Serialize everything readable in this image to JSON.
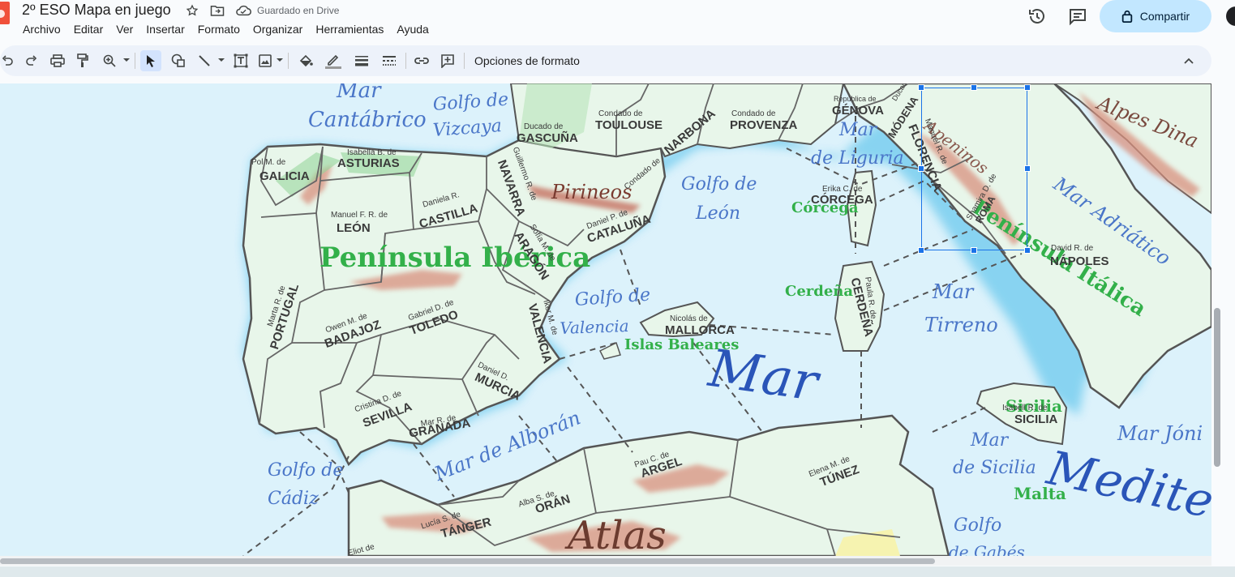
{
  "header": {
    "doc_title": "2º ESO Mapa en juego",
    "save_status": "Guardado en Drive",
    "share_label": "Compartir"
  },
  "menu": [
    "Archivo",
    "Editar",
    "Ver",
    "Insertar",
    "Formato",
    "Organizar",
    "Herramientas",
    "Ayuda"
  ],
  "toolbar": {
    "format_options": "Opciones de formato",
    "icons": [
      "undo-icon",
      "redo-icon",
      "print-icon",
      "paint-format-icon",
      "zoom-icon",
      "select-icon",
      "shape-icon",
      "line-icon",
      "textbox-icon",
      "image-icon",
      "fill-color-icon",
      "border-color-icon",
      "border-weight-icon",
      "border-dash-icon",
      "link-icon",
      "comment-icon",
      "collapse-icon"
    ]
  },
  "colors": {
    "accent": "#1a73e8",
    "share_bg": "#c2e7ff",
    "sea": "#dcf2fb",
    "land": "#e8f6ea",
    "border": "#555555"
  },
  "map": {
    "seas": {
      "mar": "Mar",
      "cantabrico": "Cantábrico",
      "golfo_vizcaya_1": "Golfo de",
      "golfo_vizcaya_2": "Vizcaya",
      "golfo_leon_1": "Golfo de",
      "golfo_leon_2": "León",
      "golfo_valencia_1": "Golfo de",
      "golfo_valencia_2": "Valencia",
      "mar_ligur_1": "Mar",
      "mar_ligur_2": "de Liguria",
      "mar_tirreno_1": "Mar",
      "mar_tirreno_2": "Tirreno",
      "mar_big": "Mar",
      "mediterraneo": "Medite",
      "mar_adriatico": "Mar Adriático",
      "mar_jonico": "Mar Jóni",
      "mar_sicilia_1": "Mar",
      "mar_sicilia_2": "de Sicilia",
      "mar_alboran": "Mar de Alborán",
      "golfo_cadiz_1": "Golfo de",
      "golfo_cadiz_2": "Cádiz",
      "golfo_gabes_1": "Golfo",
      "golfo_gabes_2": "de Gabés"
    },
    "geo": {
      "peninsula_iberica": "Península Ibérica",
      "peninsula_italica": "Península Itálica",
      "corcega": "Córcega",
      "cerdena": "Cerdeña",
      "islas_baleares": "Islas Baleares",
      "sicilia": "Sicilia",
      "malta": "Malta",
      "pirineos": "Pirineos",
      "atlas": "Atlas",
      "alpes": "Alpes Dina",
      "apeninos": "Apeninos"
    },
    "regions": {
      "galicia": {
        "owner": "Pol M. de",
        "name": "GALICIA"
      },
      "asturias": {
        "owner": "Isabella B. de",
        "name": "ASTURIAS"
      },
      "leon": {
        "owner": "Manuel F. R. de",
        "name": "LEÓN"
      },
      "castilla": {
        "owner": "Daniela R.",
        "name": "CASTILLA"
      },
      "navarra": {
        "owner": "Guillermo R. de",
        "name": "NAVARRA"
      },
      "aragon": {
        "owner": "Sofía M. de",
        "name": "ARAGÓN"
      },
      "cataluna": {
        "owner": "Daniel P. de",
        "name": "CATALUÑA"
      },
      "gascuna": {
        "owner": "Ducado de",
        "name": "GASCUÑA"
      },
      "toulouse": {
        "owner": "Condado de",
        "name": "TOULOUSE"
      },
      "narbona": {
        "owner": "Condado de",
        "name": "NARBONA"
      },
      "provenza": {
        "owner": "Condado de",
        "name": "PROVENZA"
      },
      "genova": {
        "owner": "República de",
        "name": "GÉNOVA"
      },
      "modena": {
        "owner": "Ducado de",
        "name": "MÓDENA"
      },
      "florencia": {
        "owner": "Manuel R. de",
        "name": "FLORENCIA"
      },
      "roma": {
        "owner": "Shamira D. de",
        "name": "ROMA"
      },
      "napoles": {
        "owner": "David R. de",
        "name": "NÁPOLES"
      },
      "corcega": {
        "owner": "Erika C. de",
        "name": "CÓRCEGA"
      },
      "cerdena": {
        "owner": "Paula R. de",
        "name": "CERDEÑA"
      },
      "portugal": {
        "owner": "Marta R. de",
        "name": "PORTUGAL"
      },
      "badajoz": {
        "owner": "Owen M. de",
        "name": "BADAJOZ"
      },
      "toledo": {
        "owner": "Gabriel D. de",
        "name": "TOLEDO"
      },
      "valencia": {
        "owner": "Iker M. de",
        "name": "VALENCIA"
      },
      "mallorca": {
        "owner": "Nicolás de",
        "name": "MALLORCA"
      },
      "murcia": {
        "owner": "Daniel D.",
        "name": "MURCIA"
      },
      "sevilla": {
        "owner": "Cristina D. de",
        "name": "SEVILLA"
      },
      "granada": {
        "owner": "Mar R. de",
        "name": "GRANADA"
      },
      "argel": {
        "owner": "Pau C. de",
        "name": "ARGEL"
      },
      "oran": {
        "owner": "Alba S. de",
        "name": "ORÁN"
      },
      "tanger": {
        "owner": "Lucía S. de",
        "name": "TÁNGER"
      },
      "tunez": {
        "owner": "Elena M. de",
        "name": "TÚNEZ"
      },
      "sicilia": {
        "owner": "Isabell R. de",
        "name": "SICILIA"
      },
      "eliot": {
        "owner": "Eliot de",
        "name": ""
      }
    }
  }
}
